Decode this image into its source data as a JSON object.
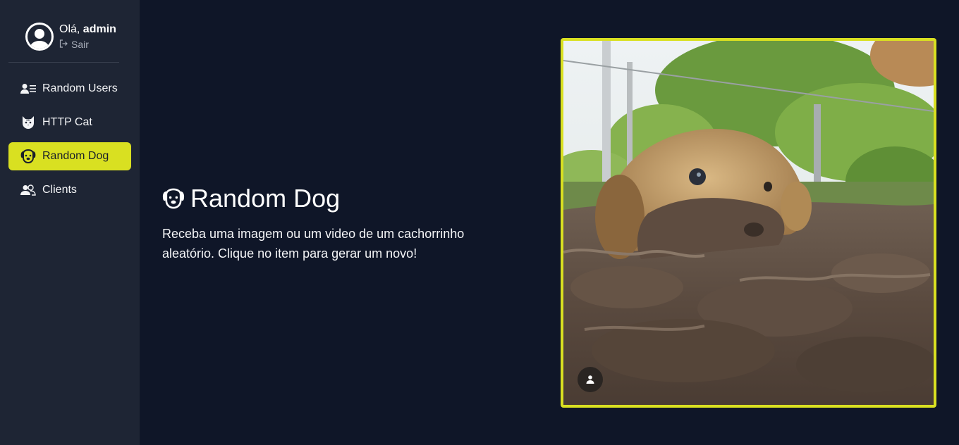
{
  "sidebar": {
    "greeting_prefix": "Olá,",
    "username": "admin",
    "logout_label": "Sair",
    "items": [
      {
        "label": "Random Users",
        "icon": "users-list-icon",
        "active": false
      },
      {
        "label": "HTTP Cat",
        "icon": "cat-icon",
        "active": false
      },
      {
        "label": "Random Dog",
        "icon": "dog-icon",
        "active": true
      },
      {
        "label": "Clients",
        "icon": "clients-icon",
        "active": false
      }
    ]
  },
  "main": {
    "title": "Random Dog",
    "description": "Receba uma imagem ou um video de um cachorrinho aleatório. Clique no item para gerar um novo!",
    "media": {
      "subject": "golden retriever puppy lying in mud",
      "icon": "user-icon"
    }
  },
  "colors": {
    "accent": "#d9e021",
    "background": "#0f1628",
    "sidebar": "#1e2534"
  }
}
